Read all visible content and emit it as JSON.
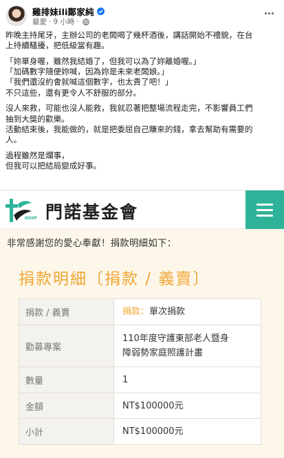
{
  "post": {
    "author": "雞排妹ili鄭家純",
    "time": "9 小時",
    "audience_prefix": "最愛",
    "verified_icon": "verified-badge-icon",
    "globe_icon": "public-globe-icon",
    "paragraphs": [
      [
        "昨晚主持尾牙，主辦公司的老闆喝了幾杯酒後，講話開始不禮貌，在台",
        "上持續騷擾，把低級當有趣。"
      ],
      [
        "「妳單身喔，雖然我結婚了，但我可以為了妳離婚喔。」",
        "「加碼數字隨便妳喊，因為妳是未來老闆娘。」",
        "「我們還沒約會就喊這個數字，也太貴了吧！」",
        "不只這些，還有更令人不舒服的部分。"
      ],
      [
        "沒人來救，可能也沒人能救，我就忍著把整場流程走完，不影響員工們",
        "抽到大獎的歡樂。",
        "活動結束後，我能做的，就是把委屈自己賺來的錢，拿去幫助有需要的",
        "人。"
      ],
      [
        "過程雖然是爛事，",
        "但我可以把結局變成好事。"
      ]
    ]
  },
  "screenshot": {
    "site_name": "門諾基金會",
    "logo_icon": "mennonite-foundation-logo-icon",
    "logo_small_text": "MSWF",
    "menu_icon": "hamburger-menu-icon",
    "thanks": "非常感謝您的愛心奉獻！捐款明細如下：",
    "detail_title": "捐款明細〔捐款 / 義賣〕",
    "rows": {
      "type": {
        "key": "捐款 / 義賣",
        "tag": "捐款：",
        "value": "單次捐款"
      },
      "project": {
        "key": "勸募專案",
        "value_line1": "110年度守護東部老人暨身",
        "value_line2": "障弱勢家庭照護計畫"
      },
      "qty": {
        "key": "數量",
        "value": "1"
      },
      "amount": {
        "key": "金額",
        "value": "NT$100000元"
      },
      "subtotal": {
        "key": "小計",
        "value": "NT$100000元"
      }
    },
    "accent_color": "#2eb398",
    "title_color": "#f0a533"
  }
}
